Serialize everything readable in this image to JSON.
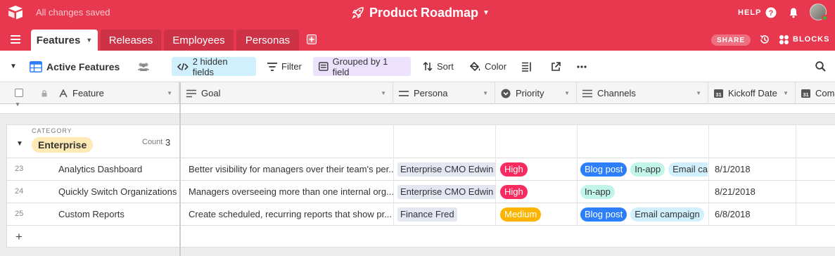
{
  "topbar": {
    "status": "All changes saved",
    "base_title": "Product Roadmap",
    "help_label": "HELP",
    "accent_color": "#e8384f"
  },
  "tabs": [
    {
      "label": "Features",
      "active": true
    },
    {
      "label": "Releases",
      "active": false
    },
    {
      "label": "Employees",
      "active": false
    },
    {
      "label": "Personas",
      "active": false
    }
  ],
  "actions": {
    "share_label": "SHARE",
    "blocks_label": "BLOCKS"
  },
  "view": {
    "name": "Active Features",
    "hidden_fields_label": "2 hidden fields",
    "filter_label": "Filter",
    "grouped_label": "Grouped by 1 field",
    "sort_label": "Sort",
    "color_label": "Color"
  },
  "columns": [
    {
      "label": "Feature",
      "icon": "text-icon"
    },
    {
      "label": "Goal",
      "icon": "long-text-icon"
    },
    {
      "label": "Persona",
      "icon": "link-icon"
    },
    {
      "label": "Priority",
      "icon": "single-select-icon"
    },
    {
      "label": "Channels",
      "icon": "multi-select-icon"
    },
    {
      "label": "Kickoff Date",
      "icon": "calendar-icon"
    },
    {
      "label": "Comp",
      "icon": "calendar-icon"
    }
  ],
  "group": {
    "category_label": "CATEGORY",
    "name": "Enterprise",
    "count_label": "Count",
    "count": "3"
  },
  "rows": [
    {
      "num": "23",
      "feature": "Analytics Dashboard",
      "goal": "Better visibility for managers over their team's per...",
      "persona": "Enterprise CMO Edwin",
      "priority": "High",
      "channels": [
        "Blog post",
        "In-app",
        "Email ca"
      ],
      "kickoff": "8/1/2018"
    },
    {
      "num": "24",
      "feature": "Quickly Switch Organizations",
      "goal": "Managers overseeing more than one internal org...",
      "persona": "Enterprise CMO Edwin",
      "priority": "High",
      "channels": [
        "In-app"
      ],
      "kickoff": "8/21/2018"
    },
    {
      "num": "25",
      "feature": "Custom Reports",
      "goal": "Create scheduled, recurring reports that show pr...",
      "persona": "Finance Fred",
      "priority": "Medium",
      "channels": [
        "Blog post",
        "Email campaign"
      ],
      "kickoff": "6/8/2018"
    }
  ],
  "colors": {
    "priority_high": "#f82b60",
    "priority_medium": "#fcb400",
    "channel_blog": "#2d7ff9",
    "channel_inapp": "#c2f5e9",
    "channel_email": "#d0f0fd",
    "category_chip": "#ffeab6"
  }
}
